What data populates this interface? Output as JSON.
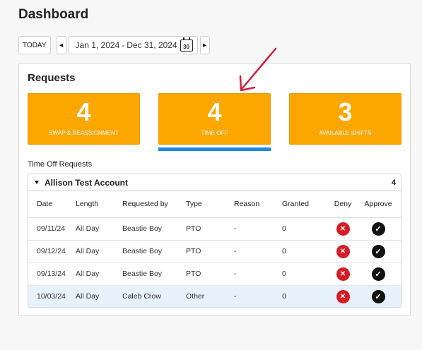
{
  "page": {
    "title": "Dashboard"
  },
  "datebar": {
    "today_label": "TODAY",
    "prev_icon": "caret-left-icon",
    "next_icon": "caret-right-icon",
    "range_start": "Jan 1, 2024",
    "range_sep": "-",
    "range_end": "Dec 31, 2024",
    "calendar_day": "30"
  },
  "requests": {
    "title": "Requests",
    "cards": [
      {
        "count": "4",
        "label": "SWAP & REASSIGNMENT"
      },
      {
        "count": "4",
        "label": "TIME OFF"
      },
      {
        "count": "3",
        "label": "AVAILABLE SHIFTS"
      }
    ],
    "active_card_color": "#1e88e5",
    "card_color": "#fca600"
  },
  "time_off": {
    "section_label": "Time Off Requests",
    "account": {
      "name": "Allison Test Account",
      "count": "4"
    },
    "columns": [
      "Date",
      "Length",
      "Requested by",
      "Type",
      "Reason",
      "Granted",
      "Deny",
      "Approve"
    ],
    "rows": [
      {
        "date": "09/11/24",
        "length": "All Day",
        "requested_by": "Beastie Boy",
        "type": "PTO",
        "reason": "-",
        "granted": "0"
      },
      {
        "date": "09/12/24",
        "length": "All Day",
        "requested_by": "Beastie Boy",
        "type": "PTO",
        "reason": "-",
        "granted": "0"
      },
      {
        "date": "09/13/24",
        "length": "All Day",
        "requested_by": "Beastie Boy",
        "type": "PTO",
        "reason": "-",
        "granted": "0"
      },
      {
        "date": "10/03/24",
        "length": "All Day",
        "requested_by": "Caleb Crow",
        "type": "Other",
        "reason": "-",
        "granted": "0"
      }
    ],
    "deny_icon": "x-circle-icon",
    "approve_icon": "check-circle-icon"
  }
}
